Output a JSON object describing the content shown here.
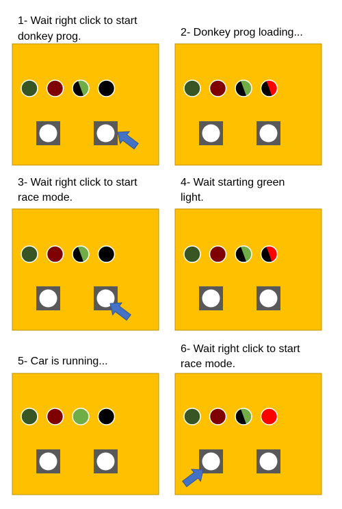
{
  "colors": {
    "panel_fill": "#FFC000",
    "panel_stroke": "#BF9000",
    "dark_green": "#375623",
    "dark_red": "#7F0000",
    "light_green": "#70AD47",
    "red": "#FF0000",
    "black": "#000000",
    "button_gray": "#595959",
    "button_face": "#FFFFFF",
    "arrow_fill": "#4472C4",
    "arrow_stroke": "#2F5597"
  },
  "steps": [
    {
      "caption_line1": "1- Wait right click to start",
      "caption_line2": "donkey prog.",
      "lights": [
        {
          "name": "light-dark-green",
          "type": "solid",
          "color": "dark_green"
        },
        {
          "name": "light-dark-red",
          "type": "solid",
          "color": "dark_red"
        },
        {
          "name": "light-split-green",
          "type": "split",
          "left": "black",
          "right": "light_green"
        },
        {
          "name": "light-black",
          "type": "solid",
          "color": "black"
        }
      ],
      "cursor": "right-button"
    },
    {
      "caption_line1": "2- Donkey prog loading...",
      "caption_line2": "",
      "lights": [
        {
          "name": "light-dark-green",
          "type": "solid",
          "color": "dark_green"
        },
        {
          "name": "light-dark-red",
          "type": "solid",
          "color": "dark_red"
        },
        {
          "name": "light-split-green",
          "type": "split",
          "left": "black",
          "right": "light_green"
        },
        {
          "name": "light-split-red",
          "type": "split",
          "left": "black",
          "right": "red"
        }
      ],
      "cursor": "none"
    },
    {
      "caption_line1": "3- Wait right click to start",
      "caption_line2": "race mode.",
      "lights": [
        {
          "name": "light-dark-green",
          "type": "solid",
          "color": "dark_green"
        },
        {
          "name": "light-dark-red",
          "type": "solid",
          "color": "dark_red"
        },
        {
          "name": "light-split-green",
          "type": "split",
          "left": "black",
          "right": "light_green"
        },
        {
          "name": "light-black",
          "type": "solid",
          "color": "black"
        }
      ],
      "cursor": "right-button"
    },
    {
      "caption_line1": "4- Wait starting green",
      "caption_line2": "light.",
      "lights": [
        {
          "name": "light-dark-green",
          "type": "solid",
          "color": "dark_green"
        },
        {
          "name": "light-dark-red",
          "type": "solid",
          "color": "dark_red"
        },
        {
          "name": "light-split-green",
          "type": "split",
          "left": "black",
          "right": "light_green"
        },
        {
          "name": "light-split-red",
          "type": "split",
          "left": "black",
          "right": "red"
        }
      ],
      "cursor": "none"
    },
    {
      "caption_line1": "5- Car is running...",
      "caption_line2": "",
      "lights": [
        {
          "name": "light-dark-green",
          "type": "solid",
          "color": "dark_green"
        },
        {
          "name": "light-dark-red",
          "type": "solid",
          "color": "dark_red"
        },
        {
          "name": "light-green",
          "type": "solid",
          "color": "light_green"
        },
        {
          "name": "light-black",
          "type": "solid",
          "color": "black"
        }
      ],
      "cursor": "none"
    },
    {
      "caption_line1": "6- Wait right click to start",
      "caption_line2": "race mode.",
      "lights": [
        {
          "name": "light-dark-green",
          "type": "solid",
          "color": "dark_green"
        },
        {
          "name": "light-dark-red",
          "type": "solid",
          "color": "dark_red"
        },
        {
          "name": "light-split-green",
          "type": "split",
          "left": "black",
          "right": "light_green"
        },
        {
          "name": "light-red",
          "type": "solid",
          "color": "red"
        }
      ],
      "cursor": "left-button"
    }
  ]
}
